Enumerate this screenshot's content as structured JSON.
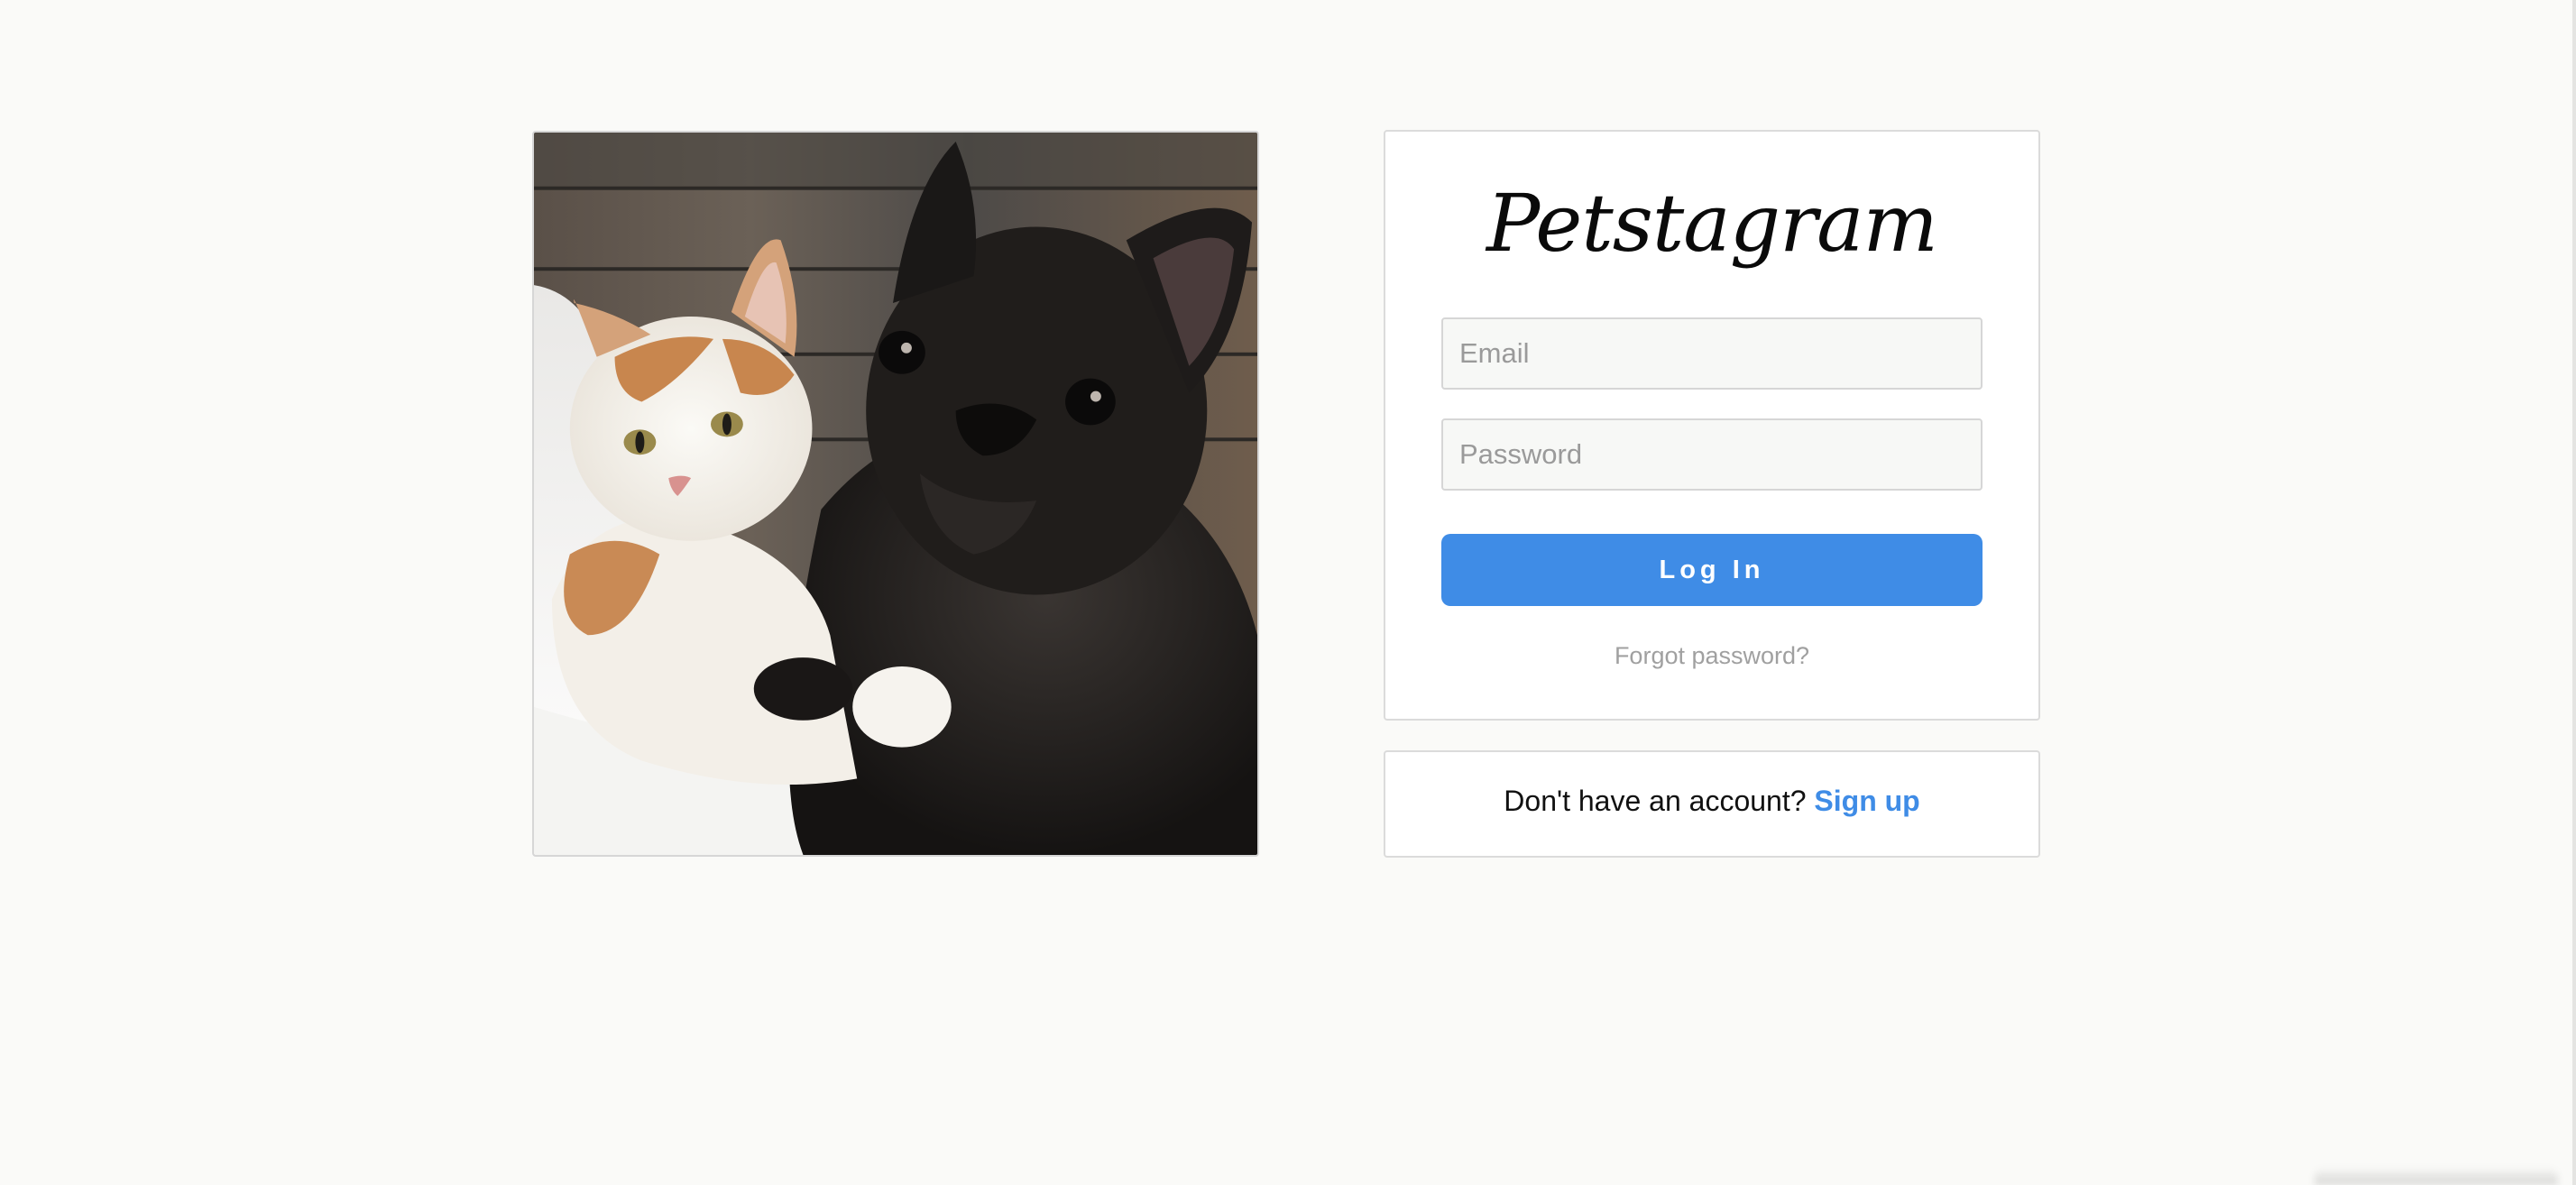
{
  "hero": {
    "image_alt": "cat-and-dog-photo"
  },
  "login": {
    "logo_text": "Petstagram",
    "email_placeholder": "Email",
    "password_placeholder": "Password",
    "login_button_label": "Log In",
    "forgot_password_label": "Forgot password?"
  },
  "signup": {
    "prompt_text": "Don't have an account?",
    "link_label": "Sign up"
  },
  "colors": {
    "accent": "#3f8ce6",
    "background": "#fafaf8",
    "panel_border": "#dbdbdb"
  }
}
